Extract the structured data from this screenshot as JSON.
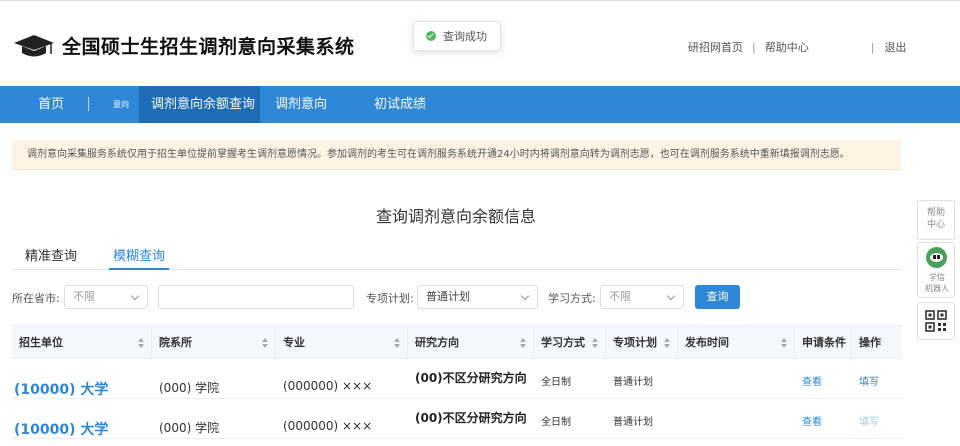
{
  "header": {
    "title": "全国硕士生招生调剂意向采集系统",
    "toast": "查询成功",
    "links": {
      "home": "研招网首页",
      "help": "帮助中心",
      "logout": "退出"
    },
    "separator": "|"
  },
  "nav": {
    "items": [
      "首页",
      "调剂意向余额查询",
      "调剂意向",
      "初试成绩"
    ],
    "small_label": "意向",
    "active": "调剂意向余额查询"
  },
  "notice": "调剂意向采集服务系统仅用于招生单位提前掌握考生调剂意愿情况。参加调剂的考生可在调剂服务系统开通24小时内将调剂意向转为调剂志愿，也可在调剂服务系统中重新填报调剂志愿。",
  "section_title": "查询调剂意向余额信息",
  "tabs": [
    "精准查询",
    "模糊查询"
  ],
  "active_tab": "模糊查询",
  "filters": {
    "province_label": "所在省市:",
    "province_value": "不限",
    "special_label": "专项计划:",
    "special_value": "普通计划",
    "mode_label": "学习方式:",
    "mode_value": "不限",
    "query_button": "查询"
  },
  "table": {
    "headers": [
      "招生单位",
      "院系所",
      "专业",
      "研究方向",
      "学习方式",
      "专项计划",
      "发布时间",
      "申请条件",
      "操作"
    ],
    "rows": [
      {
        "unit": "(10000) 大学",
        "dept": "(000) 学院",
        "major": "(000000) ×××",
        "direction": "(00)不区分研究方向",
        "mode": "全日制",
        "plan": "普通计划",
        "time": "",
        "condition": "查看",
        "action": "填写",
        "action_enabled": true
      },
      {
        "unit": "(10000) 大学",
        "dept": "(000) 学院",
        "major": "(000000) ×××",
        "direction": "(00)不区分研究方向",
        "mode": "全日制",
        "plan": "普通计划",
        "time": "",
        "condition": "查看",
        "action": "填写",
        "action_enabled": false
      }
    ]
  },
  "float_bar": {
    "help": [
      "帮助",
      "中心"
    ],
    "bot": [
      "学信",
      "机器人"
    ]
  },
  "colors": {
    "primary": "#2f87d7",
    "nav_active": "#1d6cb6",
    "notice_bg": "#fdf4e6",
    "success": "#52b65a"
  }
}
